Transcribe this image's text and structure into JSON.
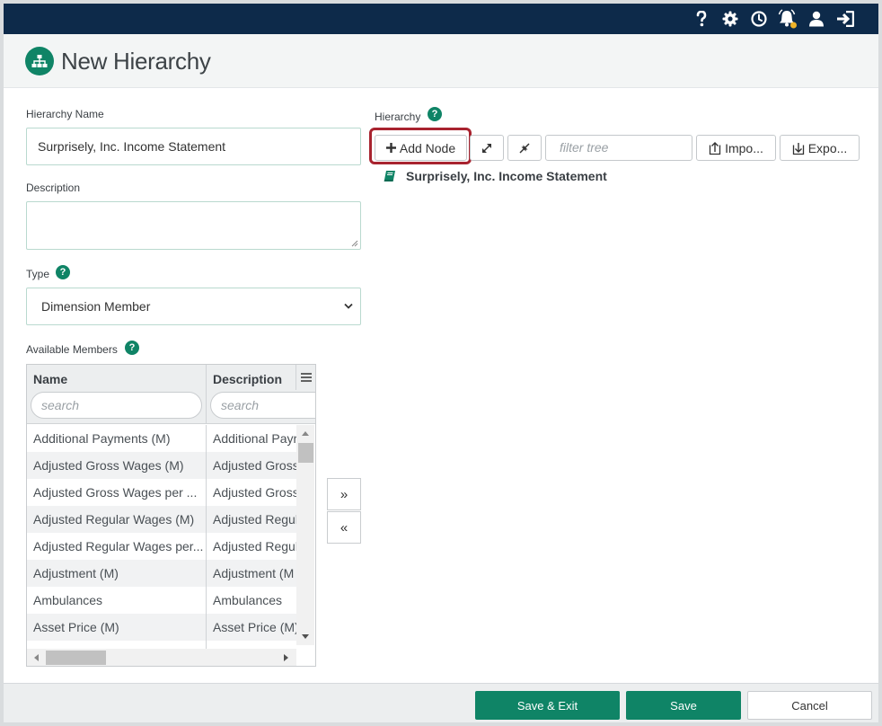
{
  "header": {
    "icons": [
      "help-icon",
      "gear-icon",
      "history-icon",
      "notifications-icon",
      "user-icon",
      "logout-icon"
    ],
    "brand_color": "#0d2a4a"
  },
  "page": {
    "title": "New Hierarchy",
    "accent_color": "#0f8466"
  },
  "form": {
    "hierarchy_name_label": "Hierarchy Name",
    "hierarchy_name_value": "Surprisely, Inc. Income Statement",
    "description_label": "Description",
    "description_value": "",
    "type_label": "Type",
    "type_value": "Dimension Member",
    "help_glyph": "?"
  },
  "members": {
    "label": "Available Members",
    "columns": [
      "Name",
      "Description"
    ],
    "search_placeholder": "search",
    "rows": [
      {
        "name": "Additional Payments (M)",
        "description": "Additional Payr"
      },
      {
        "name": "Adjusted Gross Wages (M)",
        "description": "Adjusted Gross"
      },
      {
        "name": "Adjusted Gross Wages per ...",
        "description": "Adjusted Gross"
      },
      {
        "name": "Adjusted Regular Wages (M)",
        "description": "Adjusted Regul"
      },
      {
        "name": "Adjusted Regular Wages per...",
        "description": "Adjusted Regul"
      },
      {
        "name": "Adjustment (M)",
        "description": "Adjustment (M"
      },
      {
        "name": "Ambulances",
        "description": "Ambulances"
      },
      {
        "name": "Asset Price (M)",
        "description": "Asset Price (M)"
      }
    ],
    "move_right_label": "»",
    "move_left_label": "«"
  },
  "hierarchy": {
    "label": "Hierarchy",
    "add_node_label": "Add Node",
    "filter_placeholder": "filter tree",
    "import_label": "Impo...",
    "export_label": "Expo...",
    "root_node": "Surprisely, Inc. Income Statement"
  },
  "footer": {
    "save_exit_label": "Save & Exit",
    "save_label": "Save",
    "cancel_label": "Cancel"
  }
}
